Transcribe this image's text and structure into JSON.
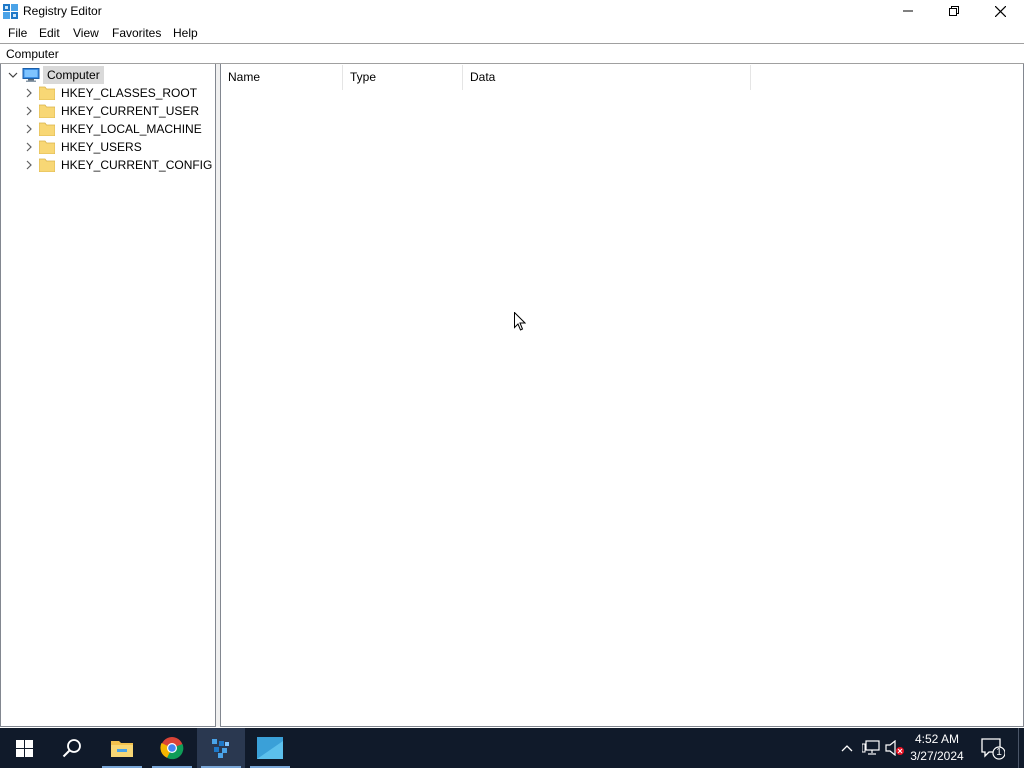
{
  "window": {
    "title": "Registry Editor",
    "controls": [
      "minimize",
      "restore",
      "close"
    ]
  },
  "menu": {
    "items": [
      "File",
      "Edit",
      "View",
      "Favorites",
      "Help"
    ]
  },
  "address": {
    "path": "Computer"
  },
  "tree": {
    "root": {
      "label": "Computer",
      "icon": "computer-icon",
      "expanded": true,
      "selected": true
    },
    "hives": [
      {
        "label": "HKEY_CLASSES_ROOT",
        "icon": "folder-icon"
      },
      {
        "label": "HKEY_CURRENT_USER",
        "icon": "folder-icon"
      },
      {
        "label": "HKEY_LOCAL_MACHINE",
        "icon": "folder-icon"
      },
      {
        "label": "HKEY_USERS",
        "icon": "folder-icon"
      },
      {
        "label": "HKEY_CURRENT_CONFIG",
        "icon": "folder-icon"
      }
    ]
  },
  "list": {
    "columns": [
      "Name",
      "Type",
      "Data"
    ],
    "rows": []
  },
  "taskbar": {
    "apps": [
      "start-icon",
      "search-icon",
      "file-explorer-icon",
      "chrome-icon",
      "registry-editor-icon",
      "app-window-icon"
    ],
    "active_app": "registry-editor-icon",
    "time": "4:52 AM",
    "date": "3/27/2024",
    "notification_count": "1"
  },
  "colors": {
    "taskbar_bg": "#101a2a",
    "selection_bg": "#d9d9d9",
    "folder": "#f8d775"
  }
}
